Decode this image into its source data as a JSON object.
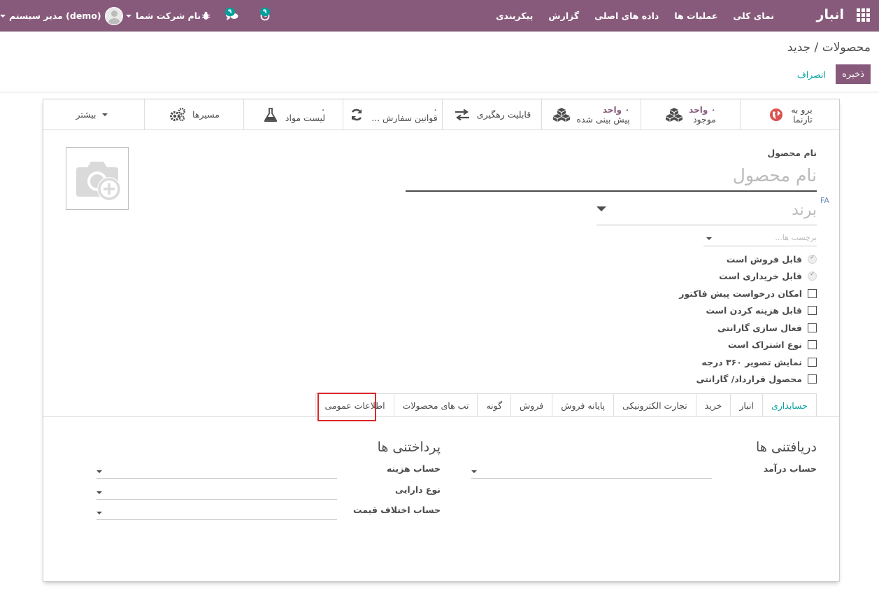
{
  "navbar": {
    "app_name": "انبار",
    "menu": [
      "نمای کلی",
      "عملیات ها",
      "داده های اصلی",
      "گزارش",
      "پیکربندی"
    ],
    "activity_count": "۹",
    "messages_count": "۹",
    "company": "نام شرکت شما",
    "user": "مدیر سیستم (demo)"
  },
  "breadcrumb": {
    "parent": "محصولات",
    "separator": "/",
    "current": "جدید"
  },
  "actions": {
    "save": "ذخیره",
    "discard": "انصراف"
  },
  "smart_buttons": [
    {
      "label": "برو به",
      "label2": "تارنما",
      "icon": "globe-icon"
    },
    {
      "value": "۰ واحد",
      "label": "موجود",
      "icon": "cubes-icon"
    },
    {
      "value": "۰ واحد",
      "label": "پیش بینی شده",
      "icon": "cubes-icon"
    },
    {
      "label": "قابلیت رهگیری",
      "icon": "exchange-icon"
    },
    {
      "value": "۰",
      "label": "قوانین سفارش ...",
      "icon": "refresh-icon"
    },
    {
      "value": "۰",
      "label": "لیست مواد",
      "icon": "flask-icon"
    },
    {
      "label": "مسیرها",
      "icon": "cogs-icon"
    },
    {
      "label": "بیشتر",
      "icon": "caret-down-icon"
    }
  ],
  "form": {
    "name_label": "نام محصول",
    "name_placeholder": "نام محصول",
    "lang_badge": "FA",
    "brand_placeholder": "برند",
    "tags_placeholder": "برچسب ها...",
    "options": [
      {
        "label": "قابل فروش است",
        "checked": true
      },
      {
        "label": "قابل خریداری است",
        "checked": true
      },
      {
        "label": "امکان درخواست پیش فاکتور",
        "checked": false
      },
      {
        "label": "قابل هزینه کردن است",
        "checked": false
      },
      {
        "label": "فعال سازی گارانتی",
        "checked": false
      },
      {
        "label": "نوع اشتراک است",
        "checked": false
      },
      {
        "label": "نمایش تصویر ۳۶۰ درجه",
        "checked": false
      },
      {
        "label": "محصول قرارداد/ گارانتی",
        "checked": false
      }
    ]
  },
  "tabs": [
    "اطلاعات عمومی",
    "تب های محصولات",
    "گونه",
    "فروش",
    "پایانه فروش",
    "تجارت الکترونیکی",
    "خرید",
    "انبار",
    "حسابداری"
  ],
  "active_tab": "حسابداری",
  "accounting": {
    "receivables_title": "دریافتنی ها",
    "income_account_label": "حساب درآمد",
    "payables_title": "پرداختنی ها",
    "expense_account_label": "حساب هزینه",
    "asset_type_label": "نوع دارایی",
    "price_diff_label": "حساب اختلاف قیمت"
  },
  "colors": {
    "brand": "#875a7b",
    "accent": "#00a09d",
    "highlight": "#d9282c"
  }
}
